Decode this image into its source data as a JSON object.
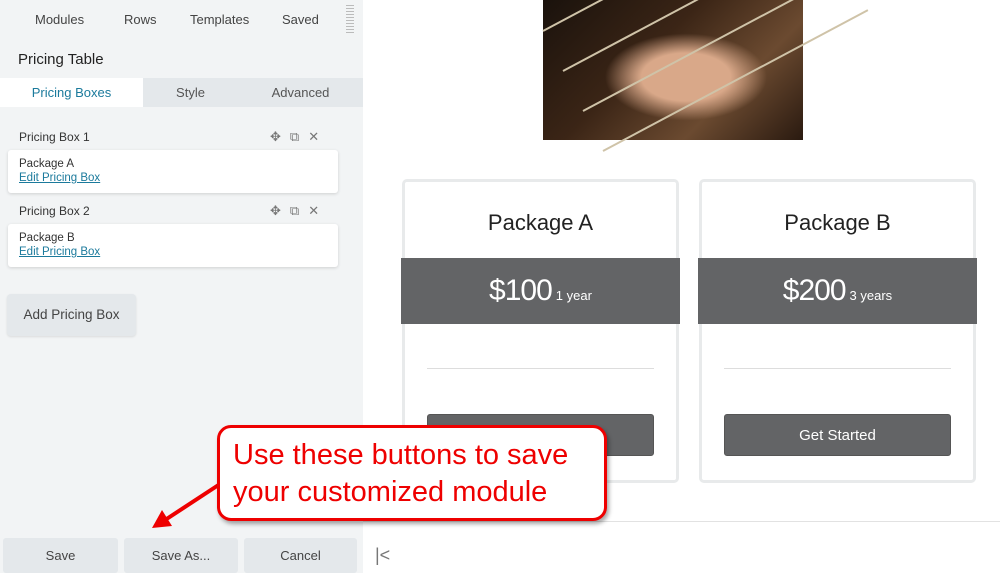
{
  "topnav": [
    "Modules",
    "Rows",
    "Templates",
    "Saved"
  ],
  "panel_title": "Pricing Table",
  "tabs": [
    "Pricing Boxes",
    "Style",
    "Advanced"
  ],
  "boxes": [
    {
      "header": "Pricing Box 1",
      "name": "Package A",
      "edit": "Edit Pricing Box"
    },
    {
      "header": "Pricing Box 2",
      "name": "Package B",
      "edit": "Edit Pricing Box"
    }
  ],
  "add_label": "Add Pricing Box",
  "bottom": {
    "save": "Save",
    "save_as": "Save As...",
    "cancel": "Cancel"
  },
  "packages": [
    {
      "name": "Package A",
      "price": "$100",
      "period": "1 year",
      "button": ""
    },
    {
      "name": "Package B",
      "price": "$200",
      "period": "3 years",
      "button": "Get Started"
    }
  ],
  "callout": {
    "line1": "Use these buttons to save",
    "line2": "your customized module"
  },
  "colors": {
    "accent": "#1b7a9c",
    "band": "#636466",
    "callout": "#e00000"
  }
}
